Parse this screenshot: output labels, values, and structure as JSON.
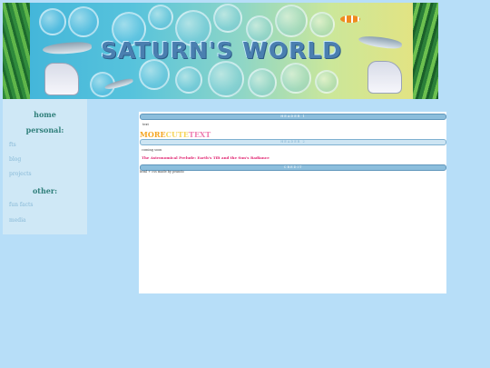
{
  "banner": {
    "title": "SATURN'S WORLD"
  },
  "sidebar": {
    "home_label": "home",
    "personal_label": "personal:",
    "personal_links": [
      {
        "label": "fts"
      },
      {
        "label": "blog"
      },
      {
        "label": "projects"
      }
    ],
    "other_label": "other:",
    "other_links": [
      {
        "label": "fun facts"
      },
      {
        "label": "media"
      }
    ]
  },
  "content": {
    "header1": "HEADER 1",
    "body1": "text",
    "rainbow_words": [
      {
        "text": "MORE",
        "color": "#f5a623"
      },
      {
        "text": "CUTE",
        "color": "#f6d55c"
      },
      {
        "text": "TEXT",
        "color": "#ef7fb2"
      }
    ],
    "header2": "HEADER 2",
    "body2": "coming soon",
    "post_link": "The Astronomical Prelude: Earth's Tilt and the Sun's Radiance",
    "credit_header": "CREDIT",
    "credit_text": "html + css made by prando"
  },
  "colors": {
    "page_bg": "#b7def8",
    "sidebar_bg": "#cfe8f6",
    "sidebar_heading": "#2f7f7a",
    "sidebar_link": "#86b8d6",
    "header_bar": "#8cbedc",
    "post_link": "#e0206e"
  }
}
